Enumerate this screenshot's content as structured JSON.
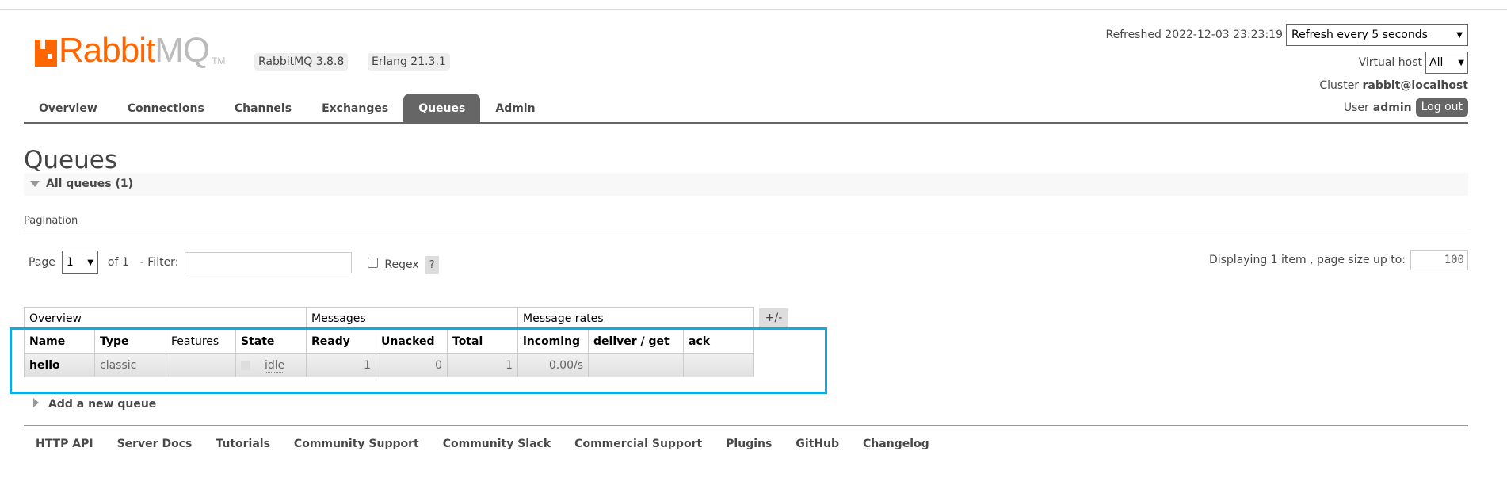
{
  "header": {
    "logo_text_primary": "Rabbit",
    "logo_text_secondary": "MQ",
    "logo_tm": "TM",
    "version_badge": "RabbitMQ 3.8.8",
    "erlang_badge": "Erlang 21.3.1",
    "brand_color": "#ff6600"
  },
  "status": {
    "refreshed": "Refreshed 2022-12-03 23:23:19",
    "refresh_select": "Refresh every 5 seconds",
    "vhost_label": "Virtual host",
    "vhost_select": "All",
    "cluster_label": "Cluster",
    "cluster_value": "rabbit@localhost",
    "user_label": "User",
    "user_value": "admin",
    "logout": "Log out"
  },
  "nav": {
    "tabs": [
      {
        "label": "Overview"
      },
      {
        "label": "Connections"
      },
      {
        "label": "Channels"
      },
      {
        "label": "Exchanges"
      },
      {
        "label": "Queues",
        "active": true
      },
      {
        "label": "Admin"
      }
    ]
  },
  "page": {
    "title": "Queues",
    "section": "All queues (1)",
    "pagination_label": "Pagination"
  },
  "pagination": {
    "page_label": "Page",
    "page_value": "1",
    "of": "of 1",
    "filter_label": "- Filter:",
    "filter_value": "",
    "regex_label": "Regex",
    "regex_checked": false,
    "help": "?",
    "displaying": "Displaying 1 item , page size up to:",
    "page_size": "100"
  },
  "table": {
    "groups": [
      "Overview",
      "Messages",
      "Message rates"
    ],
    "columns": [
      "Name",
      "Type",
      "Features",
      "State",
      "Ready",
      "Unacked",
      "Total",
      "incoming",
      "deliver / get",
      "ack"
    ],
    "rows": [
      {
        "name": "hello",
        "type": "classic",
        "features": "",
        "state": "idle",
        "ready": "1",
        "unacked": "0",
        "total": "1",
        "incoming": "0.00/s",
        "deliver_get": "",
        "ack": ""
      }
    ],
    "toggle": "+/-"
  },
  "highlight_color": "#12a8e0",
  "add_queue": "Add a new queue",
  "footer": {
    "links": [
      "HTTP API",
      "Server Docs",
      "Tutorials",
      "Community Support",
      "Community Slack",
      "Commercial Support",
      "Plugins",
      "GitHub",
      "Changelog"
    ]
  }
}
